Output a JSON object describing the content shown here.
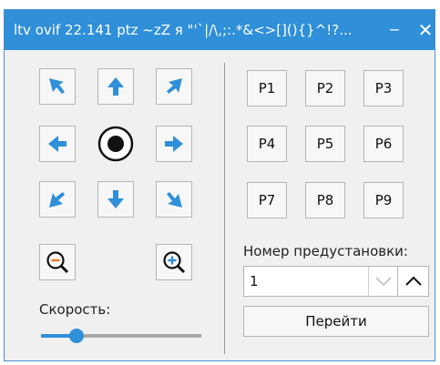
{
  "window": {
    "title": "ltv ovif 22.141 ptz ~zZ я \"'`|/\\,;:.*&<>[](){}^!?...",
    "minimize_glyph": "‒",
    "close_glyph": "✕"
  },
  "ptz": {
    "directions": [
      {
        "name": "up-left",
        "icon": "arrow-up-left-icon"
      },
      {
        "name": "up",
        "icon": "arrow-up-icon"
      },
      {
        "name": "up-right",
        "icon": "arrow-up-right-icon"
      },
      {
        "name": "left",
        "icon": "arrow-left-icon"
      },
      {
        "name": "home",
        "icon": "home-circle-icon"
      },
      {
        "name": "right",
        "icon": "arrow-right-icon"
      },
      {
        "name": "down-left",
        "icon": "arrow-down-left-icon"
      },
      {
        "name": "down",
        "icon": "arrow-down-icon"
      },
      {
        "name": "down-right",
        "icon": "arrow-down-right-icon"
      }
    ],
    "zoom_out_icon": "zoom-out-icon",
    "zoom_in_icon": "zoom-in-icon",
    "speed_label": "Скорость:",
    "speed_level": 0.22
  },
  "presets": {
    "buttons": [
      "P1",
      "P2",
      "P3",
      "P4",
      "P5",
      "P6",
      "P7",
      "P8",
      "P9"
    ],
    "number_label": "Номер предустановки:",
    "number_value": "1",
    "go_label": "Перейти"
  },
  "colors": {
    "accent": "#2f8fd9",
    "zoom_out_accent": "#e07a1f",
    "zoom_in_accent": "#2f8fd9"
  }
}
